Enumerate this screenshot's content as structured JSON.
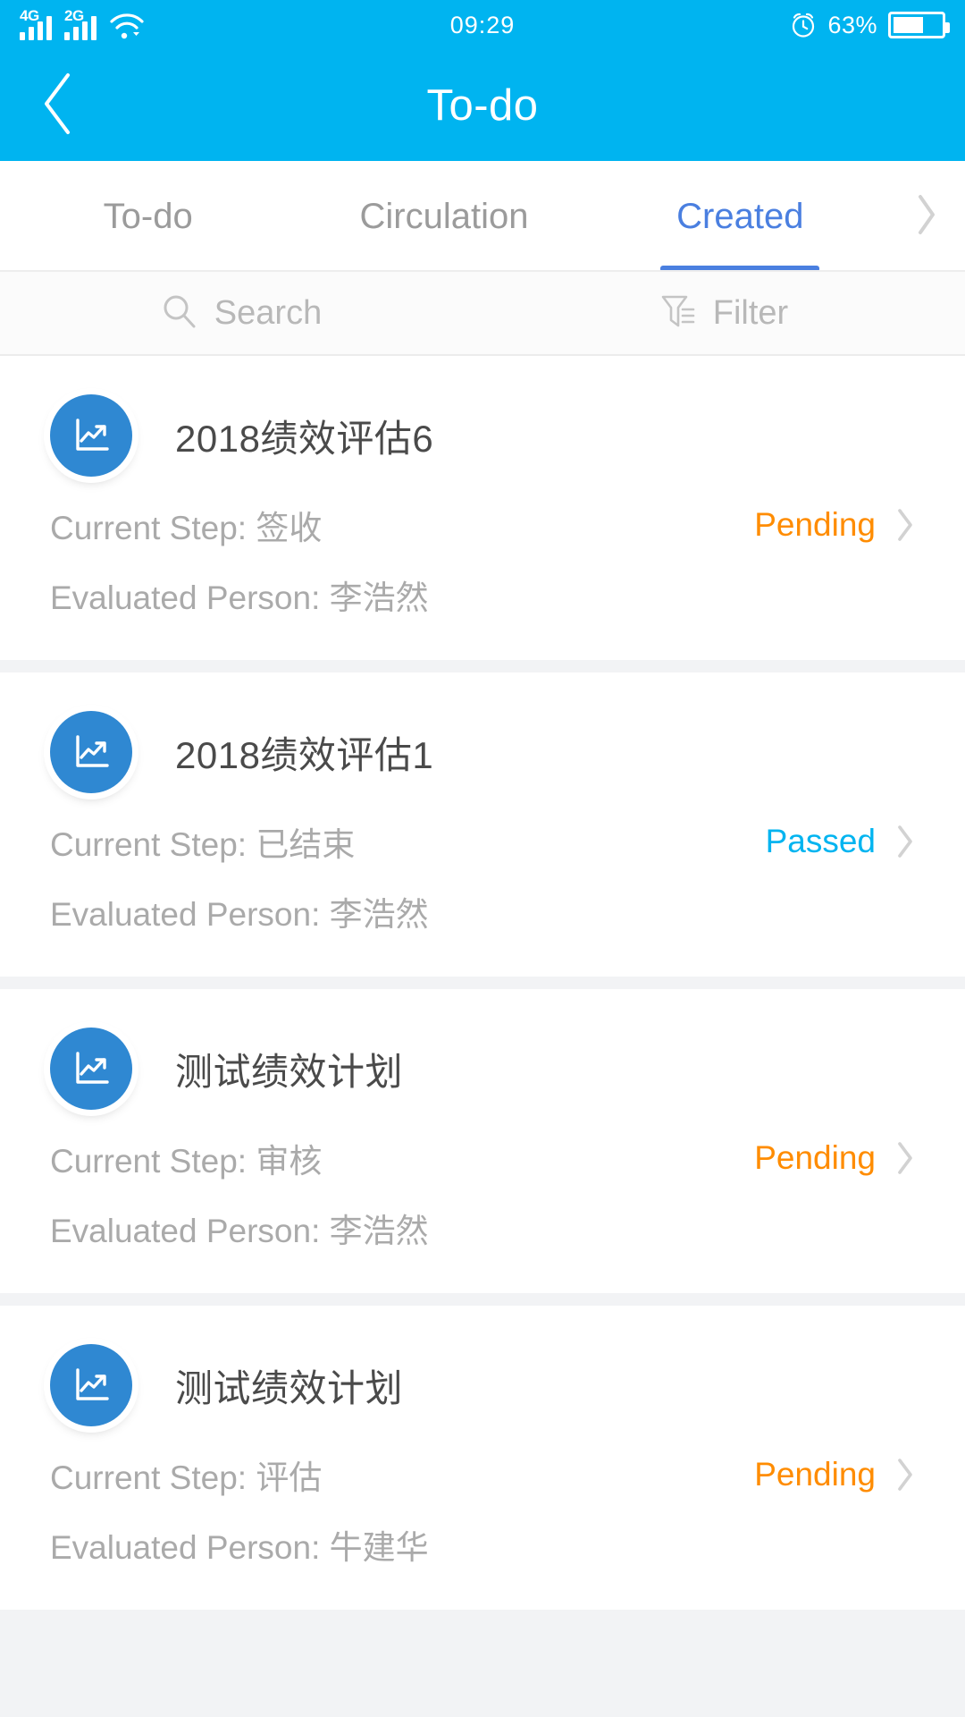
{
  "status_bar": {
    "sim1_network": "4G",
    "sim2_network": "2G",
    "wifi_icon": "wifi-icon",
    "time": "09:29",
    "alarm_icon": "alarm-clock-icon",
    "battery_percent": "63%",
    "battery_level": 63
  },
  "nav": {
    "back_icon": "chevron-left-icon",
    "title": "To-do"
  },
  "tabs": {
    "items": [
      {
        "label": "To-do",
        "active": false
      },
      {
        "label": "Circulation",
        "active": false
      },
      {
        "label": "Created",
        "active": true
      }
    ],
    "more_icon": "chevron-right-icon",
    "active_color": "#4a7fe0"
  },
  "toolbar": {
    "search_icon": "search-icon",
    "search_label": "Search",
    "filter_icon": "filter-icon",
    "filter_label": "Filter"
  },
  "labels": {
    "current_step": "Current Step:",
    "evaluated_person": "Evaluated Person:"
  },
  "colors": {
    "header_blue": "#00b4f0",
    "pending_orange": "#ff8c00",
    "passed_blue": "#00b4f0",
    "avatar_blue": "#2f88d2"
  },
  "list": {
    "items": [
      {
        "icon": "chart-trend-icon",
        "title": "2018绩效评估6",
        "current_step": "签收",
        "evaluated_person": "李浩然",
        "status": "Pending",
        "status_type": "pending",
        "chevron_icon": "chevron-right-icon"
      },
      {
        "icon": "chart-trend-icon",
        "title": "2018绩效评估1",
        "current_step": "已结束",
        "evaluated_person": "李浩然",
        "status": "Passed",
        "status_type": "passed",
        "chevron_icon": "chevron-right-icon"
      },
      {
        "icon": "chart-trend-icon",
        "title": "测试绩效计划",
        "current_step": "审核",
        "evaluated_person": "李浩然",
        "status": "Pending",
        "status_type": "pending",
        "chevron_icon": "chevron-right-icon"
      },
      {
        "icon": "chart-trend-icon",
        "title": "测试绩效计划",
        "current_step": "评估",
        "evaluated_person": "牛建华",
        "status": "Pending",
        "status_type": "pending",
        "chevron_icon": "chevron-right-icon"
      }
    ]
  }
}
